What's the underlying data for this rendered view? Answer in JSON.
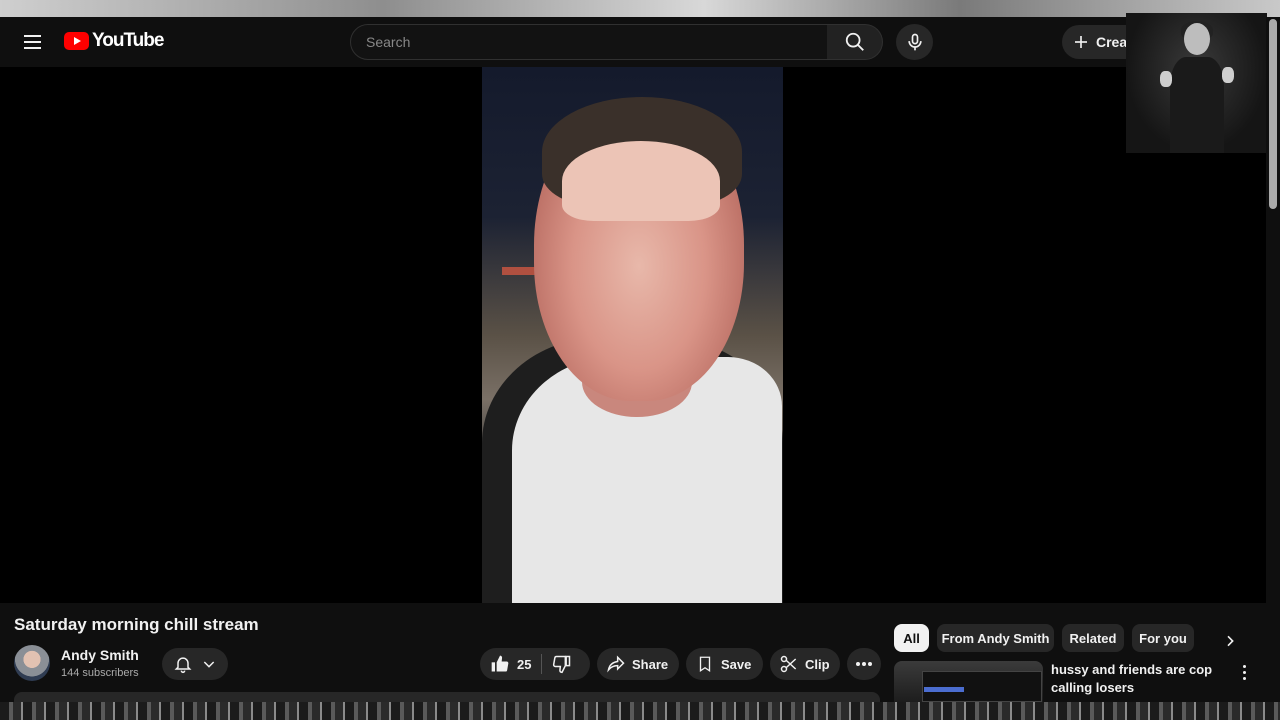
{
  "masthead": {
    "logo_text": "YouTube",
    "search_placeholder": "Search",
    "create_label": "Create"
  },
  "video": {
    "title": "Saturday morning chill stream"
  },
  "channel": {
    "name": "Andy Smith",
    "subscribers": "144 subscribers"
  },
  "actions": {
    "like_count": "25",
    "share_label": "Share",
    "save_label": "Save",
    "clip_label": "Clip"
  },
  "chips": [
    {
      "label": "All",
      "active": true
    },
    {
      "label": "From Andy Smith",
      "active": false
    },
    {
      "label": "Related",
      "active": false
    },
    {
      "label": "For you",
      "active": false
    }
  ],
  "recommendations": [
    {
      "title": "hussy and friends are cop calling losers"
    }
  ],
  "colors": {
    "background": "#0f0f0f",
    "surface": "#272727",
    "brand_red": "#ff0000",
    "text_primary": "#f1f1f1",
    "text_secondary": "#aaaaaa"
  },
  "icons": [
    "menu-icon",
    "youtube-logo-icon",
    "search-icon",
    "mic-icon",
    "plus-icon",
    "bell-icon",
    "chevron-down-icon",
    "thumbs-up-icon",
    "thumbs-down-icon",
    "share-icon",
    "bookmark-icon",
    "scissors-icon",
    "more-horizontal-icon",
    "chevron-right-icon",
    "more-vertical-icon"
  ]
}
